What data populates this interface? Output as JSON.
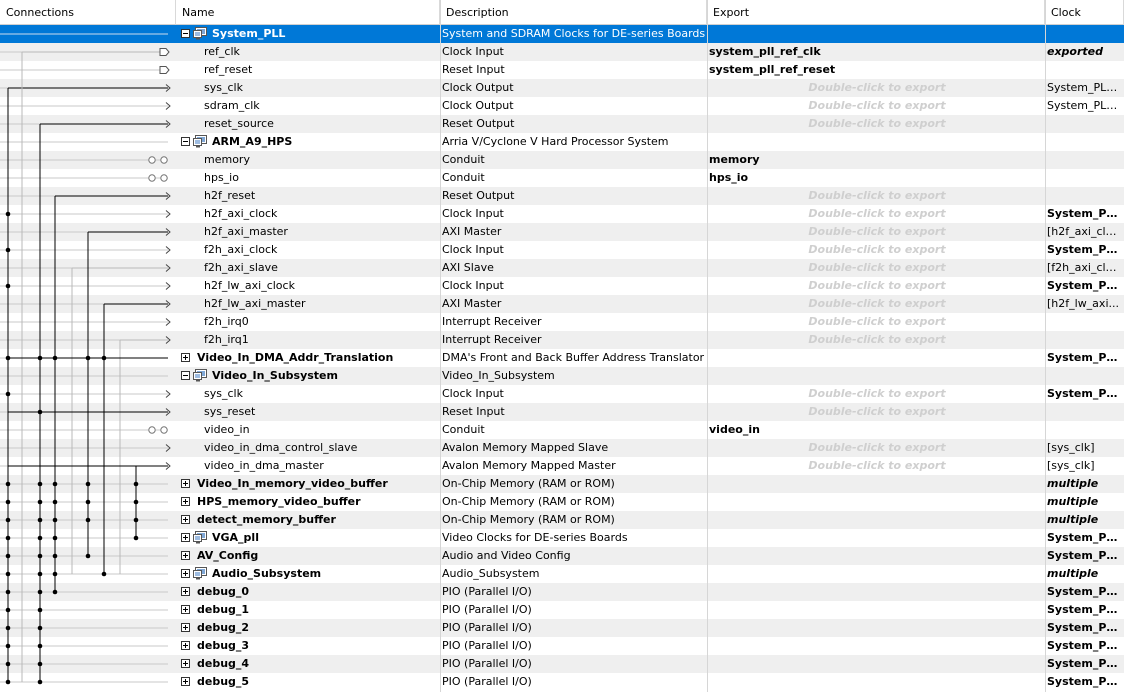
{
  "headers": {
    "connections": "Connections",
    "name": "Name",
    "description": "Description",
    "export": "Export",
    "clock": "Clock"
  },
  "rows": [
    {
      "kind": "module",
      "expanded": true,
      "icon": true,
      "name": "System_PLL",
      "desc": "System and SDRAM Clocks for DE-series Boards",
      "export": "",
      "clock": "",
      "selected": true
    },
    {
      "kind": "port",
      "name": "ref_clk",
      "desc": "Clock Input",
      "export": "system_pll_ref_clk",
      "clock": "exported",
      "clock_style": "bi"
    },
    {
      "kind": "port",
      "name": "ref_reset",
      "desc": "Reset Input",
      "export": "system_pll_ref_reset",
      "clock": ""
    },
    {
      "kind": "port",
      "name": "sys_clk",
      "desc": "Clock Output",
      "export": "Double-click to export",
      "clock": "System_PLL..."
    },
    {
      "kind": "port",
      "name": "sdram_clk",
      "desc": "Clock Output",
      "export": "Double-click to export",
      "clock": "System_PLL..."
    },
    {
      "kind": "port",
      "name": "reset_source",
      "desc": "Reset Output",
      "export": "Double-click to export",
      "clock": ""
    },
    {
      "kind": "module",
      "expanded": true,
      "icon": true,
      "name": "ARM_A9_HPS",
      "desc": "Arria V/Cyclone V Hard Processor System",
      "export": "",
      "clock": ""
    },
    {
      "kind": "port",
      "name": "memory",
      "desc": "Conduit",
      "export": "memory",
      "clock": ""
    },
    {
      "kind": "port",
      "name": "hps_io",
      "desc": "Conduit",
      "export": "hps_io",
      "clock": ""
    },
    {
      "kind": "port",
      "name": "h2f_reset",
      "desc": "Reset Output",
      "export": "Double-click to export",
      "clock": ""
    },
    {
      "kind": "port",
      "name": "h2f_axi_clock",
      "desc": "Clock Input",
      "export": "Double-click to export",
      "clock": "System_PL...",
      "clock_style": "bold"
    },
    {
      "kind": "port",
      "name": "h2f_axi_master",
      "desc": "AXI Master",
      "export": "Double-click to export",
      "clock": "[h2f_axi_clo..."
    },
    {
      "kind": "port",
      "name": "f2h_axi_clock",
      "desc": "Clock Input",
      "export": "Double-click to export",
      "clock": "System_PL...",
      "clock_style": "bold"
    },
    {
      "kind": "port",
      "name": "f2h_axi_slave",
      "desc": "AXI Slave",
      "export": "Double-click to export",
      "clock": "[f2h_axi_clo..."
    },
    {
      "kind": "port",
      "name": "h2f_lw_axi_clock",
      "desc": "Clock Input",
      "export": "Double-click to export",
      "clock": "System_PL...",
      "clock_style": "bold"
    },
    {
      "kind": "port",
      "name": "h2f_lw_axi_master",
      "desc": "AXI Master",
      "export": "Double-click to export",
      "clock": "[h2f_lw_axi..."
    },
    {
      "kind": "port",
      "name": "f2h_irq0",
      "desc": "Interrupt Receiver",
      "export": "Double-click to export",
      "clock": ""
    },
    {
      "kind": "port",
      "name": "f2h_irq1",
      "desc": "Interrupt Receiver",
      "export": "Double-click to export",
      "clock": ""
    },
    {
      "kind": "module",
      "expanded": false,
      "icon": false,
      "name": "Video_In_DMA_Addr_Translation",
      "desc": "DMA's Front and Back Buffer Address Translator",
      "export": "",
      "clock": "System_PL...",
      "clock_style": "bold"
    },
    {
      "kind": "module",
      "expanded": true,
      "icon": true,
      "name": "Video_In_Subsystem",
      "desc": "Video_In_Subsystem",
      "export": "",
      "clock": ""
    },
    {
      "kind": "port",
      "name": "sys_clk",
      "desc": "Clock Input",
      "export": "Double-click to export",
      "clock": "System_PL...",
      "clock_style": "bold"
    },
    {
      "kind": "port",
      "name": "sys_reset",
      "desc": "Reset Input",
      "export": "Double-click to export",
      "clock": ""
    },
    {
      "kind": "port",
      "name": "video_in",
      "desc": "Conduit",
      "export": "video_in",
      "clock": ""
    },
    {
      "kind": "port",
      "name": "video_in_dma_control_slave",
      "desc": "Avalon Memory Mapped Slave",
      "export": "Double-click to export",
      "clock": "[sys_clk]"
    },
    {
      "kind": "port",
      "name": "video_in_dma_master",
      "desc": "Avalon Memory Mapped Master",
      "export": "Double-click to export",
      "clock": "[sys_clk]"
    },
    {
      "kind": "module",
      "expanded": false,
      "icon": false,
      "name": "Video_In_memory_video_buffer",
      "desc": "On-Chip Memory (RAM or ROM)",
      "export": "",
      "clock": "multiple",
      "clock_style": "bi"
    },
    {
      "kind": "module",
      "expanded": false,
      "icon": false,
      "name": "HPS_memory_video_buffer",
      "desc": "On-Chip Memory (RAM or ROM)",
      "export": "",
      "clock": "multiple",
      "clock_style": "bi"
    },
    {
      "kind": "module",
      "expanded": false,
      "icon": false,
      "name": "detect_memory_buffer",
      "desc": "On-Chip Memory (RAM or ROM)",
      "export": "",
      "clock": "multiple",
      "clock_style": "bi"
    },
    {
      "kind": "module",
      "expanded": false,
      "icon": true,
      "name": "VGA_pll",
      "desc": "Video Clocks for DE-series Boards",
      "export": "",
      "clock": "System_PL...",
      "clock_style": "bold"
    },
    {
      "kind": "module",
      "expanded": false,
      "icon": false,
      "name": "AV_Config",
      "desc": "Audio and Video Config",
      "export": "",
      "clock": "System_PL...",
      "clock_style": "bold"
    },
    {
      "kind": "module",
      "expanded": false,
      "icon": true,
      "name": "Audio_Subsystem",
      "desc": "Audio_Subsystem",
      "export": "",
      "clock": "multiple",
      "clock_style": "bi"
    },
    {
      "kind": "module",
      "expanded": false,
      "icon": false,
      "name": "debug_0",
      "desc": "PIO (Parallel I/O)",
      "export": "",
      "clock": "System_PL...",
      "clock_style": "bold"
    },
    {
      "kind": "module",
      "expanded": false,
      "icon": false,
      "name": "debug_1",
      "desc": "PIO (Parallel I/O)",
      "export": "",
      "clock": "System_PL...",
      "clock_style": "bold"
    },
    {
      "kind": "module",
      "expanded": false,
      "icon": false,
      "name": "debug_2",
      "desc": "PIO (Parallel I/O)",
      "export": "",
      "clock": "System_PL...",
      "clock_style": "bold"
    },
    {
      "kind": "module",
      "expanded": false,
      "icon": false,
      "name": "debug_3",
      "desc": "PIO (Parallel I/O)",
      "export": "",
      "clock": "System_PL...",
      "clock_style": "bold"
    },
    {
      "kind": "module",
      "expanded": false,
      "icon": false,
      "name": "debug_4",
      "desc": "PIO (Parallel I/O)",
      "export": "",
      "clock": "System_PL...",
      "clock_style": "bold"
    },
    {
      "kind": "module",
      "expanded": false,
      "icon": false,
      "name": "debug_5",
      "desc": "PIO (Parallel I/O)",
      "export": "",
      "clock": "System_PL...",
      "clock_style": "bold"
    }
  ]
}
